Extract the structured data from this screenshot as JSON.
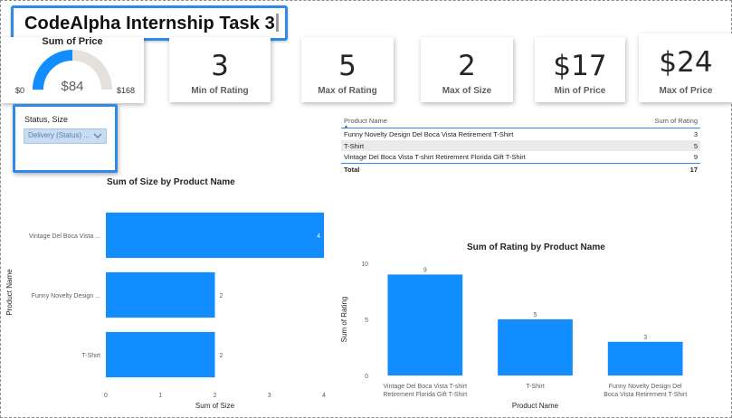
{
  "report": {
    "title": "CodeAlpha Internship Task 3",
    "accent_color": "#2f8ae8",
    "bar_color": "#118dff"
  },
  "gauge": {
    "title": "Sum of Price",
    "value": "$84",
    "min": "$0",
    "max": "$168",
    "value_num": 84,
    "min_num": 0,
    "max_num": 168,
    "fill_color": "#118dff",
    "track_color": "#e6e0da"
  },
  "kpis": [
    {
      "value": "3",
      "label": "Min of Rating"
    },
    {
      "value": "5",
      "label": "Max of Rating"
    },
    {
      "value": "2",
      "label": "Max of Size"
    },
    {
      "value": "$17",
      "label": "Min of Price"
    },
    {
      "value": "$24",
      "label": "Max of Price"
    }
  ],
  "slicer": {
    "header": "Status, Size",
    "selected": "Delivery (Status) ...",
    "icon": "chevron-down-icon"
  },
  "table": {
    "columns": [
      "Product Name",
      "Sum of Rating"
    ],
    "rows": [
      [
        "Funny Novelty Design Del Boca Vista Retirement T-Shirt",
        "3"
      ],
      [
        "T-Shirt",
        "5"
      ],
      [
        "Vintage Del Boca Vista T-shirt Retirement Florida Gift T-Shirt",
        "9"
      ]
    ],
    "total": [
      "Total",
      "17"
    ]
  },
  "chart_data": [
    {
      "type": "bar",
      "orientation": "horizontal",
      "title": "Sum of Size by Product Name",
      "xlabel": "Sum of Size",
      "ylabel": "Product Name",
      "categories": [
        "Vintage Del Boca Vista ...",
        "Funny Novelty Design ...",
        "T-Shirt"
      ],
      "values": [
        4,
        2,
        2
      ],
      "xlim": [
        0,
        4
      ],
      "xticks": [
        "0",
        "1",
        "2",
        "3",
        "4"
      ],
      "data_labels": true,
      "grid": false
    },
    {
      "type": "bar",
      "orientation": "vertical",
      "title": "Sum of Rating by Product Name",
      "xlabel": "Product Name",
      "ylabel": "Sum of Rating",
      "categories": [
        [
          "Vintage Del Boca Vista T-shirt",
          "Retirement Florida Gift T-Shirt"
        ],
        [
          "T-Shirt"
        ],
        [
          "Funny Novelty Design Del",
          "Boca Vista Retirement T-Shirt"
        ]
      ],
      "values": [
        9,
        5,
        3
      ],
      "ylim": [
        0,
        10
      ],
      "yticks": [
        "0",
        "5",
        "10"
      ],
      "data_labels": true,
      "grid": false
    }
  ]
}
